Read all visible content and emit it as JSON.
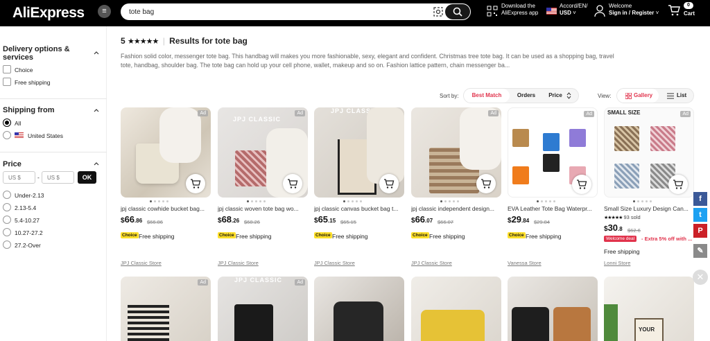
{
  "header": {
    "logo": "AliExpress",
    "search_value": "tote bag",
    "download_line1": "Download the",
    "download_line2": "AliExpress app",
    "locale_line1": "Accord/EN/",
    "locale_line2": "USD",
    "welcome_line1": "Welcome",
    "welcome_line2": "Sign in / Register",
    "cart_label": "Cart",
    "cart_count": "0"
  },
  "sidebar": {
    "delivery_title": "Delivery options & services",
    "delivery_options": [
      "Choice",
      "Free shipping"
    ],
    "shipping_title": "Shipping from",
    "shipping_options": [
      "All",
      "United States"
    ],
    "price_title": "Price",
    "price_min_placeholder": "US $",
    "price_max_placeholder": "US $",
    "price_dash": "-",
    "ok_label": "OK",
    "price_ranges": [
      "Under-2.13",
      "2.13-5.4",
      "5.4-10.27",
      "10.27-27.2",
      "27.2-Over"
    ]
  },
  "results": {
    "count": "5",
    "stars": "★★★★★",
    "text": "Results for tote bag",
    "description": "Fashion solid color, messenger tote bag. This handbag will makes you more fashionable, sexy, elegant and confident. Christmas tree tote bag. It can be used as a shopping bag, travel tote, handbag, shoulder bag. The tote bag can hold up your cell phone, wallet, makeup and so on. Fashion lattice pattern, chain messenger ba...",
    "sort_by_label": "Sort by:",
    "sort_options": [
      "Best Match",
      "Orders",
      "Price"
    ],
    "view_label": "View:",
    "view_options": [
      "Gallery",
      "List"
    ]
  },
  "products": [
    {
      "title": "jpj classic cowhide bucket bag...",
      "price_int": "66",
      "price_dec": ".86",
      "old_price": "$66.86",
      "tag": "Choice",
      "shipping": "Free shipping",
      "store": "JPJ Classic Store",
      "ad": "Ad",
      "overlay": ""
    },
    {
      "title": "jpj classic woven tote bag wo...",
      "price_int": "68",
      "price_dec": ".26",
      "old_price": "$68.26",
      "tag": "Choice",
      "shipping": "Free shipping",
      "store": "JPJ Classic Store",
      "ad": "Ad",
      "overlay": "JPJ CLASSIC"
    },
    {
      "title": "jpj classic canvas bucket bag t...",
      "price_int": "65",
      "price_dec": ".15",
      "old_price": "$65.15",
      "tag": "Choice",
      "shipping": "Free shipping",
      "store": "JPJ Classic Store",
      "ad": "Ad",
      "overlay": "JPJ CLASSIC"
    },
    {
      "title": "jpj classic independent design...",
      "price_int": "66",
      "price_dec": ".07",
      "old_price": "$66.07",
      "tag": "Choice",
      "shipping": "Free shipping",
      "store": "JPJ Classic Store",
      "ad": "Ad",
      "overlay": ""
    },
    {
      "title": "EVA Leather Tote Bag Waterpr...",
      "price_int": "29",
      "price_dec": ".84",
      "old_price": "$29.84",
      "tag": "Choice",
      "shipping": "Free shipping",
      "store": "Vanessa Store",
      "ad": "Ad",
      "overlay": ""
    },
    {
      "title": "Small Size Luxury Design Can...",
      "price_int": "30",
      "price_dec": ".8",
      "old_price": "$62.6",
      "rating_stars": "★★★★★",
      "sold": "93 sold",
      "welcome_deal": "Welcome deal",
      "extra": "- Extra 5% off with ...",
      "shipping": "Free shipping",
      "store": "Lonni Store",
      "ad": "Ad",
      "overlay": "SMALL SIZE"
    }
  ],
  "row2": [
    {
      "ad": "Ad",
      "overlay": ""
    },
    {
      "ad": "Ad",
      "overlay": "JPJ CLASSIC"
    },
    {
      "ad": "",
      "overlay": ""
    },
    {
      "ad": "",
      "overlay": ""
    },
    {
      "ad": "",
      "overlay": ""
    },
    {
      "ad": "",
      "overlay": "YOUR"
    }
  ],
  "social": [
    "f",
    "t",
    "P",
    "✎"
  ],
  "close": "✕",
  "currency": "$"
}
